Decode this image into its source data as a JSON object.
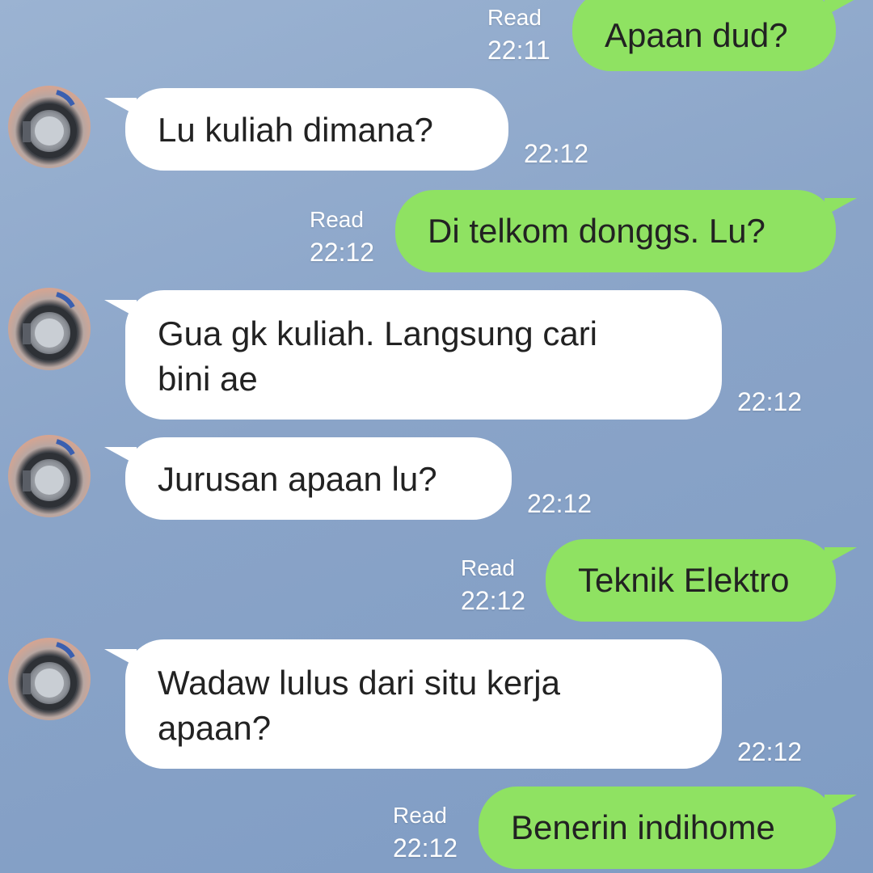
{
  "messages": [
    {
      "side": "out",
      "text": "Apaan dud?",
      "status": "Read",
      "time": "22:11"
    },
    {
      "side": "in",
      "text": "Lu kuliah dimana?",
      "time": "22:12"
    },
    {
      "side": "out",
      "text": "Di telkom donggs. Lu?",
      "status": "Read",
      "time": "22:12"
    },
    {
      "side": "in",
      "text_line1": "Gua gk kuliah. Langsung cari",
      "text_line2": "bini ae",
      "time": "22:12"
    },
    {
      "side": "in",
      "text": "Jurusan apaan lu?",
      "time": "22:12"
    },
    {
      "side": "out",
      "text": "Teknik Elektro",
      "status": "Read",
      "time": "22:12"
    },
    {
      "side": "in",
      "text_line1": "Wadaw lulus dari situ kerja",
      "text_line2": "apaan?",
      "time": "22:12"
    },
    {
      "side": "out",
      "text": "Benerin indihome",
      "status": "Read",
      "time": "22:12"
    }
  ],
  "colors": {
    "outgoing_bubble": "#8fe262",
    "incoming_bubble": "#ffffff",
    "background": "#8aa4c8"
  },
  "icons": {
    "avatar": "contact-avatar-icon"
  }
}
